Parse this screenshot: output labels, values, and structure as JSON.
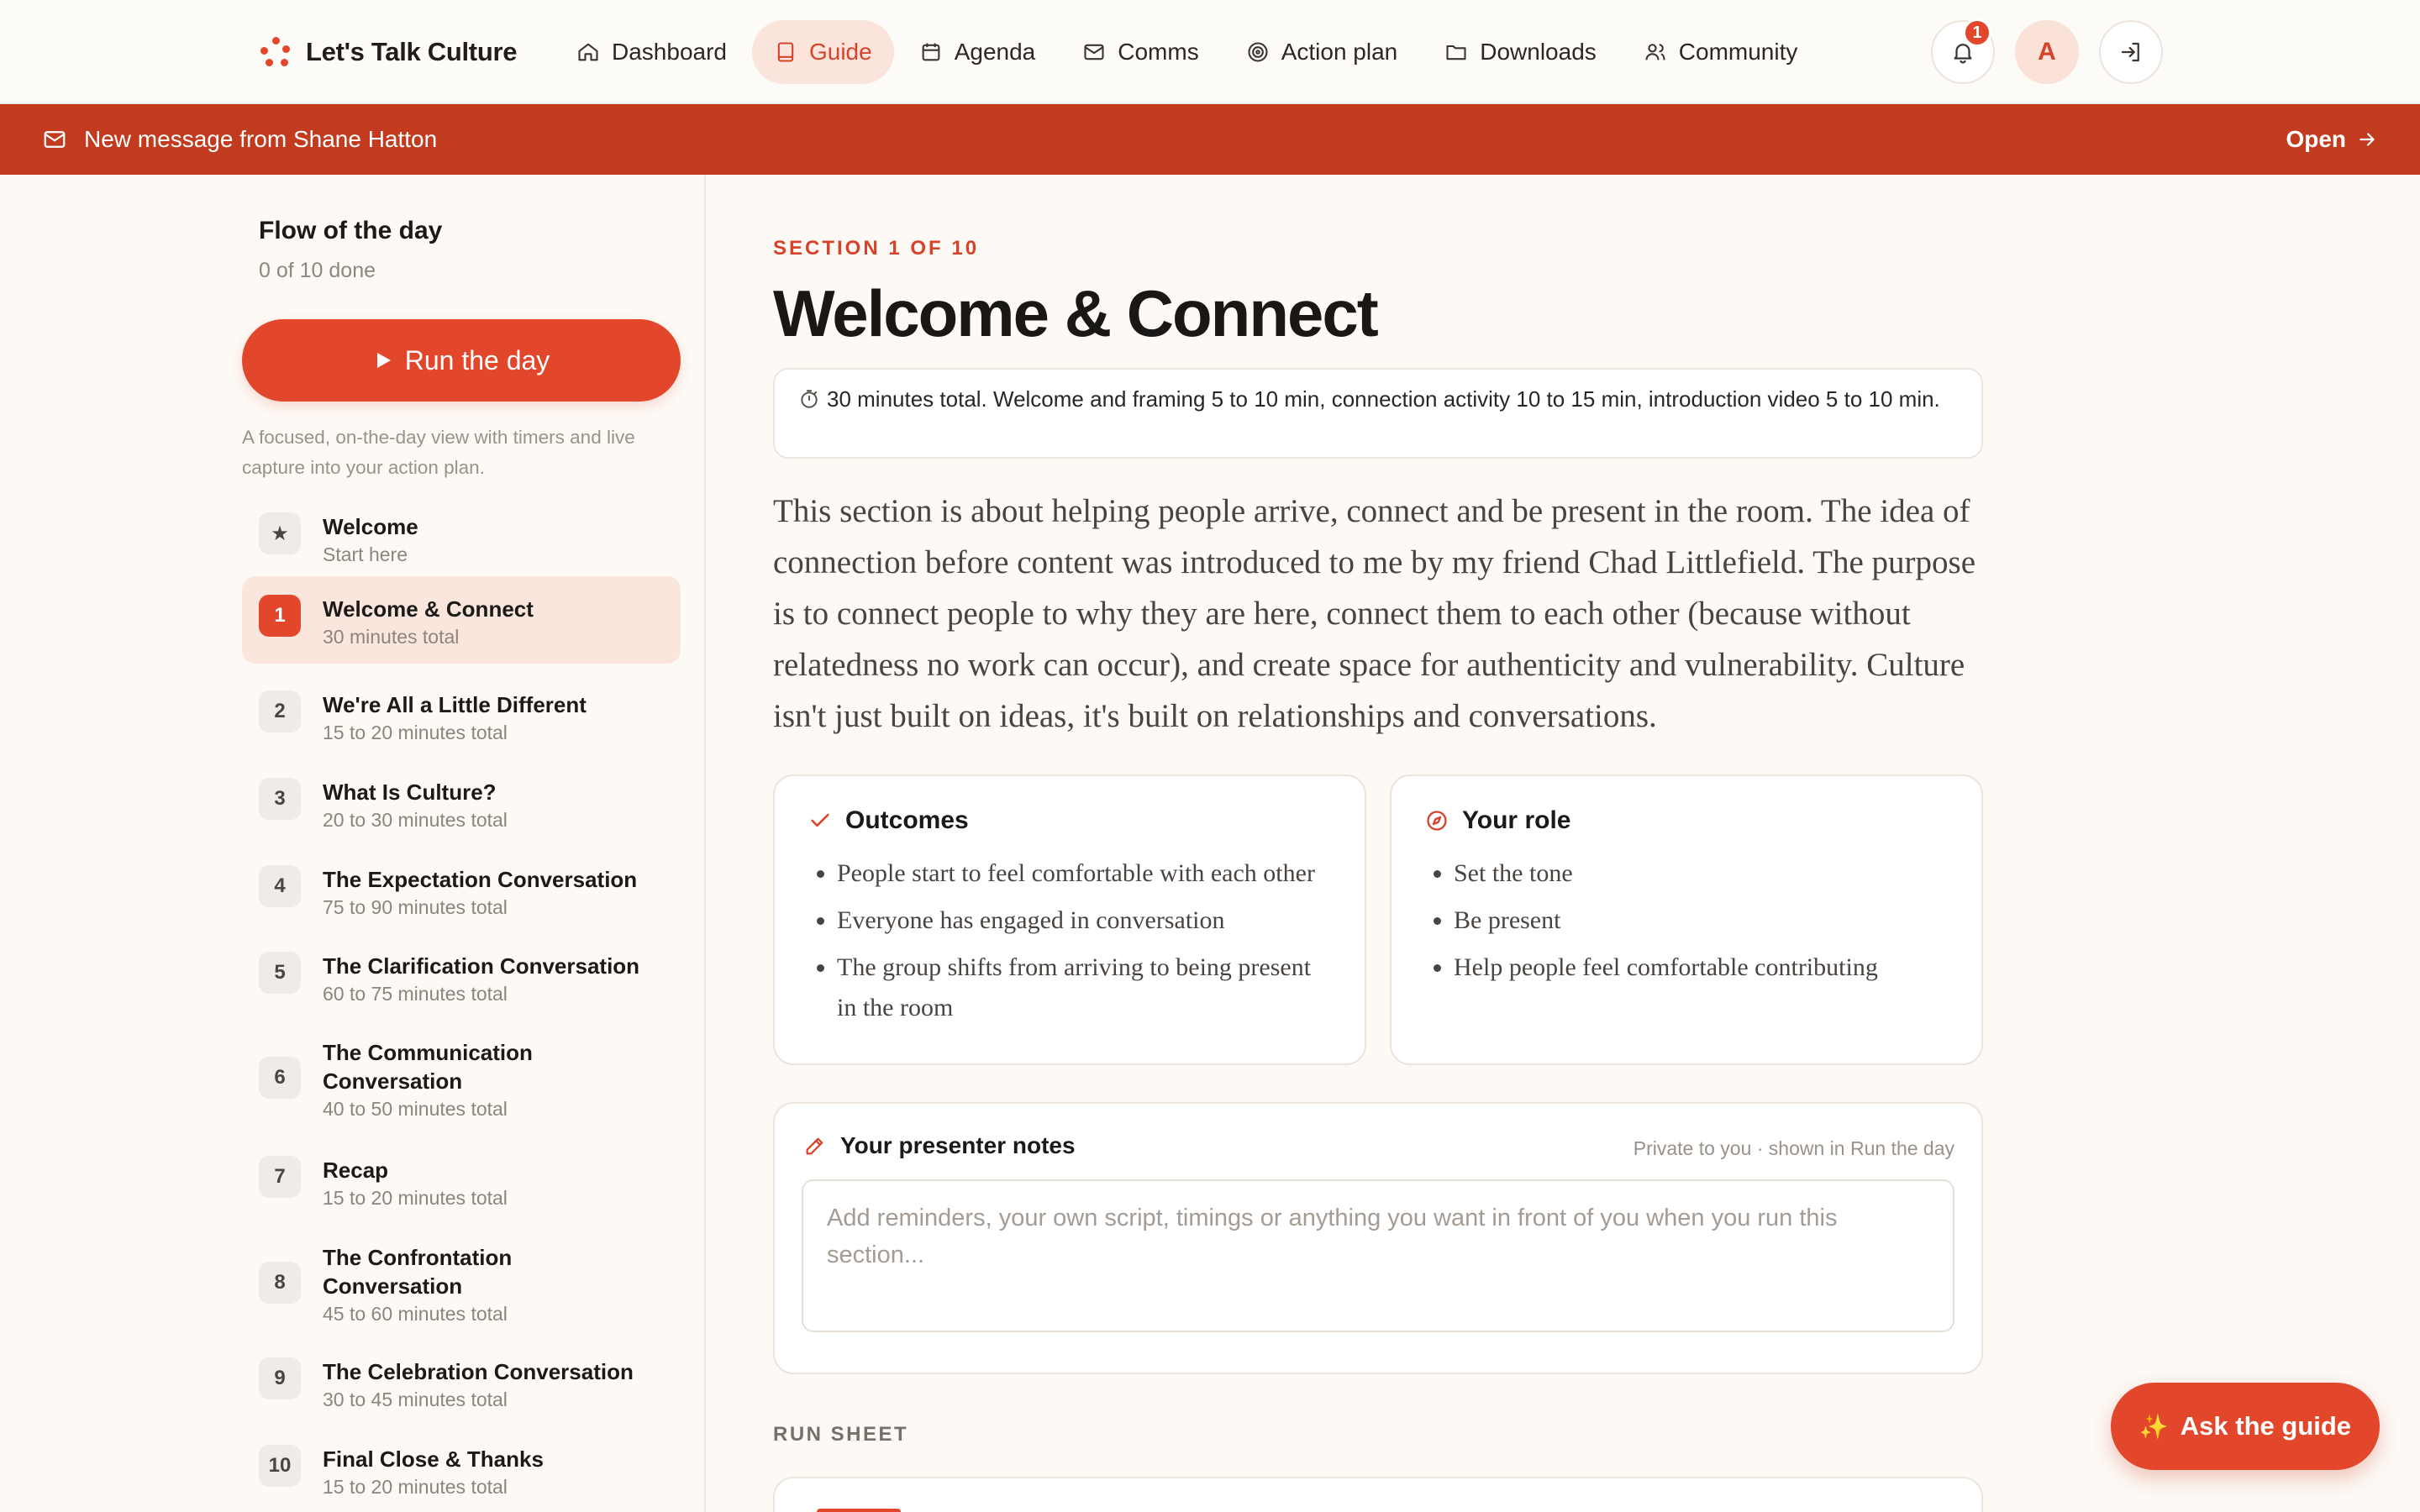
{
  "brand": {
    "name": "Let's Talk Culture"
  },
  "nav": [
    {
      "label": "Dashboard",
      "icon": "home-icon"
    },
    {
      "label": "Guide",
      "icon": "book-icon",
      "active": true
    },
    {
      "label": "Agenda",
      "icon": "calendar-icon"
    },
    {
      "label": "Comms",
      "icon": "mail-icon"
    },
    {
      "label": "Action plan",
      "icon": "target-icon"
    },
    {
      "label": "Downloads",
      "icon": "folder-icon"
    },
    {
      "label": "Community",
      "icon": "users-icon"
    }
  ],
  "header": {
    "notification_count": "1",
    "avatar_initial": "A"
  },
  "banner": {
    "message": "New message from Shane Hatton",
    "action": "Open"
  },
  "sidebar": {
    "title": "Flow of the day",
    "progress": "0 of 10 done",
    "run_button": "Run the day",
    "description": "A focused, on-the-day view with timers and live capture into your action plan.",
    "steps": [
      {
        "num": "★",
        "title": "Welcome",
        "sub": "Start here"
      },
      {
        "num": "1",
        "title": "Welcome & Connect",
        "sub": "30 minutes total",
        "active": true
      },
      {
        "num": "2",
        "title": "We're All a Little Different",
        "sub": "15 to 20 minutes total"
      },
      {
        "num": "3",
        "title": "What Is Culture?",
        "sub": "20 to 30 minutes total"
      },
      {
        "num": "4",
        "title": "The Expectation Conversation",
        "sub": "75 to 90 minutes total"
      },
      {
        "num": "5",
        "title": "The Clarification Conversation",
        "sub": "60 to 75 minutes total"
      },
      {
        "num": "6",
        "title": "The Communication Conversation",
        "sub": "40 to 50 minutes total"
      },
      {
        "num": "7",
        "title": "Recap",
        "sub": "15 to 20 minutes total"
      },
      {
        "num": "8",
        "title": "The Confrontation Conversation",
        "sub": "45 to 60 minutes total"
      },
      {
        "num": "9",
        "title": "The Celebration Conversation",
        "sub": "30 to 45 minutes total"
      },
      {
        "num": "10",
        "title": "Final Close & Thanks",
        "sub": "15 to 20 minutes total"
      }
    ]
  },
  "main": {
    "section_label": "SECTION 1 OF 10",
    "title": "Welcome & Connect",
    "timing": "30 minutes total. Welcome and framing 5 to 10 min, connection activity 10 to 15 min, introduction video 5 to 10 min.",
    "intro": "This section is about helping people arrive, connect and be present in the room. The idea of connection before content was introduced to me by my friend Chad Littlefield. The purpose is to connect people to why they are here, connect them to each other (because without relatedness no work can occur), and create space for authenticity and vulnerability. Culture isn't just built on ideas, it's built on relationships and conversations.",
    "outcomes": {
      "title": "Outcomes",
      "items": [
        "People start to feel comfortable with each other",
        "Everyone has engaged in conversation",
        "The group shifts from arriving to being present in the room"
      ]
    },
    "role": {
      "title": "Your role",
      "items": [
        "Set the tone",
        "Be present",
        "Help people feel comfortable contributing"
      ]
    },
    "notes": {
      "title": "Your presenter notes",
      "private": "Private to you · shown in Run the day",
      "placeholder": "Add reminders, your own script, timings or anything you want in front of you when you run this section..."
    },
    "run_sheet_label": "RUN SHEET"
  },
  "ask_button": "Ask the guide",
  "colors": {
    "accent": "#e2472c",
    "banner": "#c23b1e",
    "background": "#fdf9f5"
  }
}
